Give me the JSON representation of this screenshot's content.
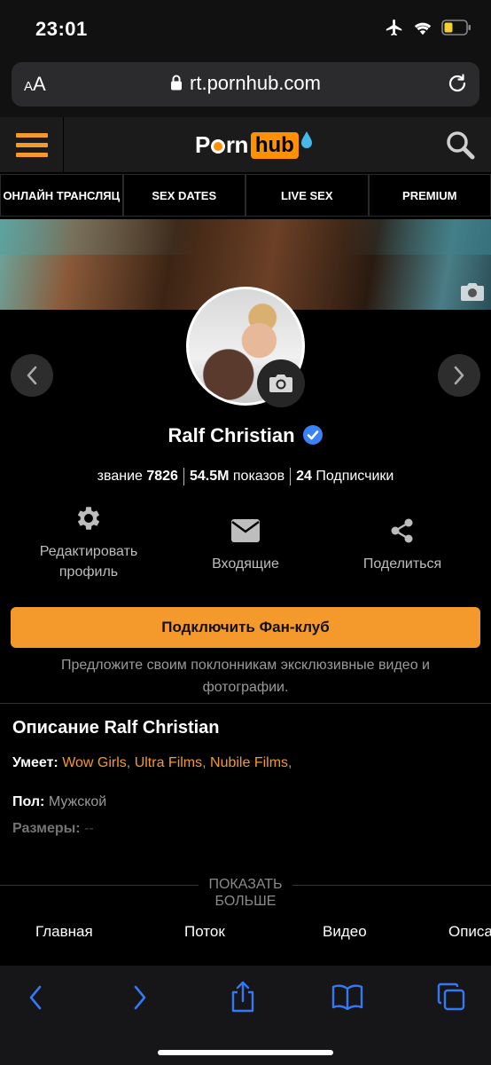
{
  "status": {
    "time": "23:01"
  },
  "browser": {
    "text_size": "AA",
    "url": "rt.pornhub.com"
  },
  "site": {
    "logo_part1": "P",
    "logo_part1b": "rn",
    "logo_part2": "hub",
    "nav": [
      "ОНЛАЙН ТРАНСЛЯЦ",
      "SEX DATES",
      "LIVE SEX",
      "PREMIUM"
    ]
  },
  "profile": {
    "name": "Ralf Christian",
    "rank_label": "звание",
    "rank_value": "7826",
    "views_value": "54.5M",
    "views_label": "показов",
    "subs_value": "24",
    "subs_label": "Подписчики",
    "actions": {
      "edit": "Редактировать профиль",
      "inbox": "Входящие",
      "share": "Поделиться"
    },
    "fanclub_button": "Подключить Фан-клуб",
    "fanclub_desc": "Предложите своим поклонникам эксклюзивные видео и фотографии."
  },
  "about": {
    "title": "Описание Ralf Christian",
    "skills_label": "Умеет:",
    "skills": [
      "Wow Girls",
      "Ultra Films",
      "Nubile Films"
    ],
    "gender_label": "Пол:",
    "gender_value": "Мужской",
    "size_label": "Размеры:",
    "size_value": "--",
    "show_more_1": "ПОКАЗАТЬ",
    "show_more_2": "БОЛЬШЕ"
  },
  "tabs": [
    "Главная",
    "Поток",
    "Видео",
    "Описа"
  ],
  "colors": {
    "accent": "#f49a2c",
    "verified": "#3b82f6",
    "safari_blue": "#3478f6"
  }
}
